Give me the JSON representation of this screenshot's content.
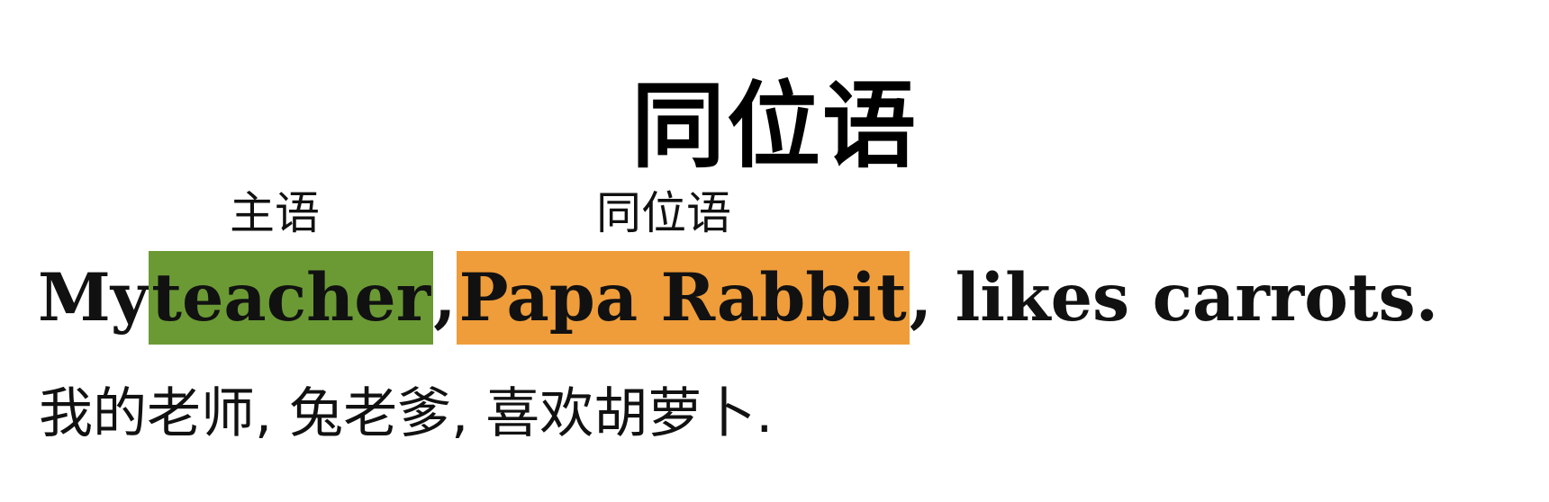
{
  "title": "同位语",
  "labels": {
    "subject": "主语",
    "appositive": "同位语"
  },
  "sentence": {
    "prefix": "My ",
    "subject": "teacher",
    "comma1": ", ",
    "appositive": "Papa Rabbit",
    "suffix": ", likes carrots."
  },
  "translation": "我的老师, 兔老爹, 喜欢胡萝卜.",
  "colors": {
    "subject_highlight": "#6b9a35",
    "appositive_highlight": "#ef9d3a"
  }
}
